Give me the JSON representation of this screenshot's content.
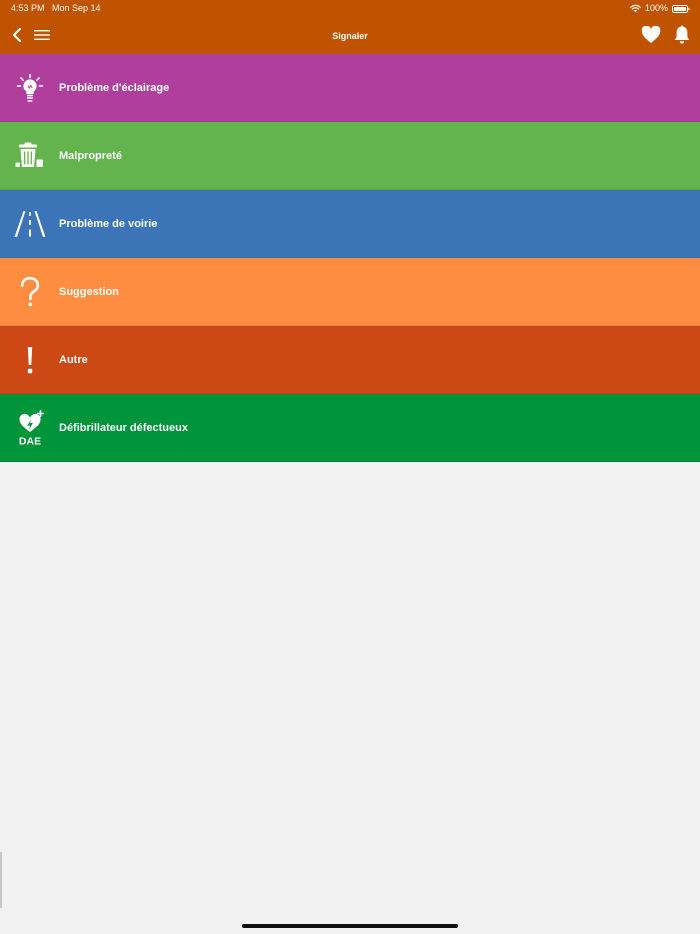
{
  "status_bar": {
    "time": "4:53 PM",
    "date": "Mon Sep 14",
    "battery": "100%"
  },
  "navbar": {
    "title": "Signaler",
    "icons": [
      "back-chevron-icon",
      "hamburger-menu-icon",
      "heart-icon",
      "bell-icon"
    ]
  },
  "colors": {
    "navbar": "#bf5300",
    "background": "#f2f2f2",
    "lighting": "#b03e9c",
    "cleanliness": "#64b44e",
    "road": "#3b75b8",
    "suggestion": "#fe8d41",
    "other": "#cc4815",
    "defibrillator": "#00943a"
  },
  "categories": [
    {
      "label": "Problème d'éclairage",
      "icon": "lightbulb-icon",
      "color": "#b03e9c"
    },
    {
      "label": "Malpropreté",
      "icon": "trash-can-icon",
      "color": "#64b44e"
    },
    {
      "label": "Problème de voirie",
      "icon": "road-icon",
      "color": "#3b75b8"
    },
    {
      "label": "Suggestion",
      "icon": "question-mark-icon",
      "color": "#fe8d41"
    },
    {
      "label": "Autre",
      "icon": "exclamation-icon",
      "color": "#cc4815"
    },
    {
      "label": "Défibrillateur défectueux",
      "icon": "defibrillator-icon",
      "color": "#00943a",
      "icon_text": "DAE"
    }
  ]
}
